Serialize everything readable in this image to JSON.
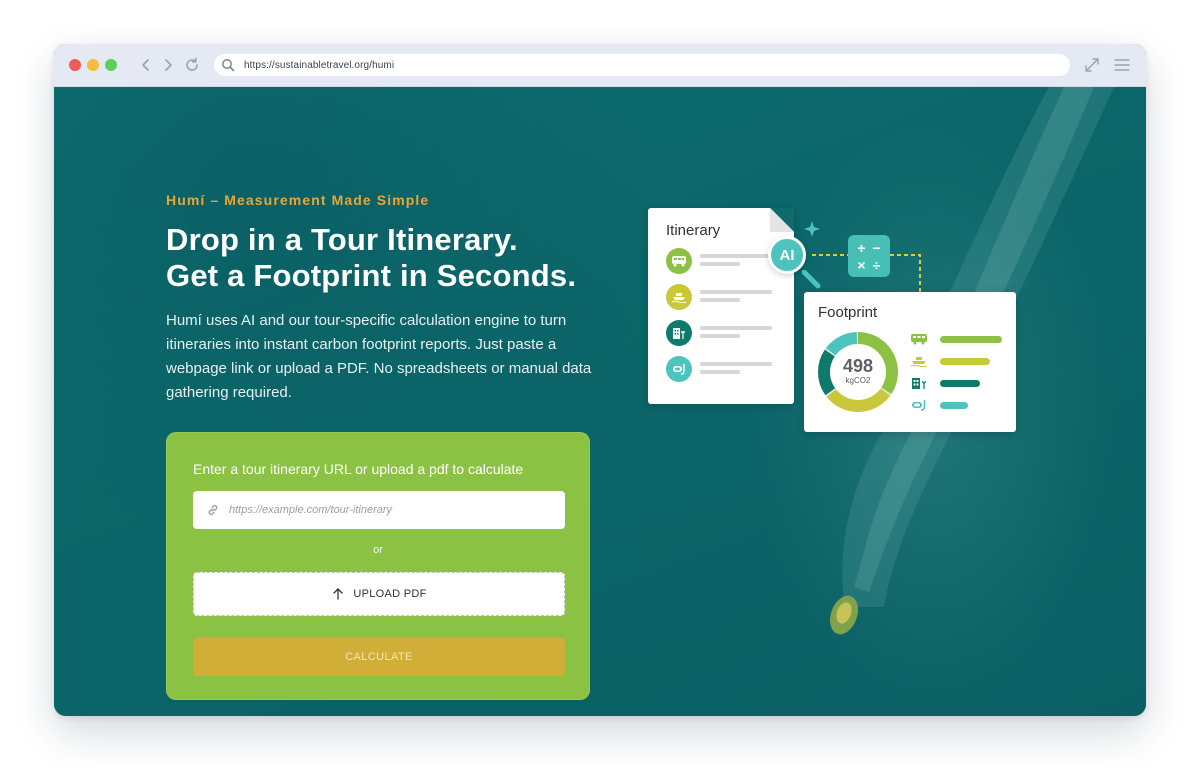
{
  "browser": {
    "url": "https://sustainabletravel.org/humi"
  },
  "hero": {
    "eyebrow": "Humí – Measurement Made Simple",
    "headline_line1": "Drop in a Tour Itinerary.",
    "headline_line2": "Get a Footprint in Seconds.",
    "intro": "Humí uses AI and our tour-specific calculation engine to turn itineraries into instant carbon footprint reports. Just paste a webpage link or upload a PDF. No spreadsheets or manual data gathering required."
  },
  "form": {
    "label": "Enter a tour itinerary URL or upload a pdf to calculate",
    "url_placeholder": "https://example.com/tour-itinerary",
    "url_value": "",
    "or_text": "or",
    "upload_label": "UPLOAD PDF",
    "calculate_label": "CALCULATE"
  },
  "illustration": {
    "itinerary_title": "Itinerary",
    "ai_label": "AI",
    "calc_symbols": [
      "+",
      "−",
      "×",
      "÷"
    ],
    "footprint_title": "Footprint",
    "footprint_value": "498",
    "footprint_unit": "kgCO2",
    "itinerary_icons": [
      "bus-icon",
      "boat-icon",
      "hotel-icon",
      "snorkel-icon"
    ],
    "footprint_icons": [
      "bus-icon",
      "boat-icon",
      "hotel-icon",
      "snorkel-icon"
    ],
    "footprint_shares": [
      0.35,
      0.3,
      0.2,
      0.15
    ]
  },
  "colors": {
    "eyebrow": "#e9a53a",
    "form_background": "#8bc243",
    "calculate_button": "#d1ae38",
    "bus": "#8bc243",
    "boat": "#c8c83a",
    "hotel": "#0f7a6c",
    "snorkel": "#4cc3bd"
  }
}
